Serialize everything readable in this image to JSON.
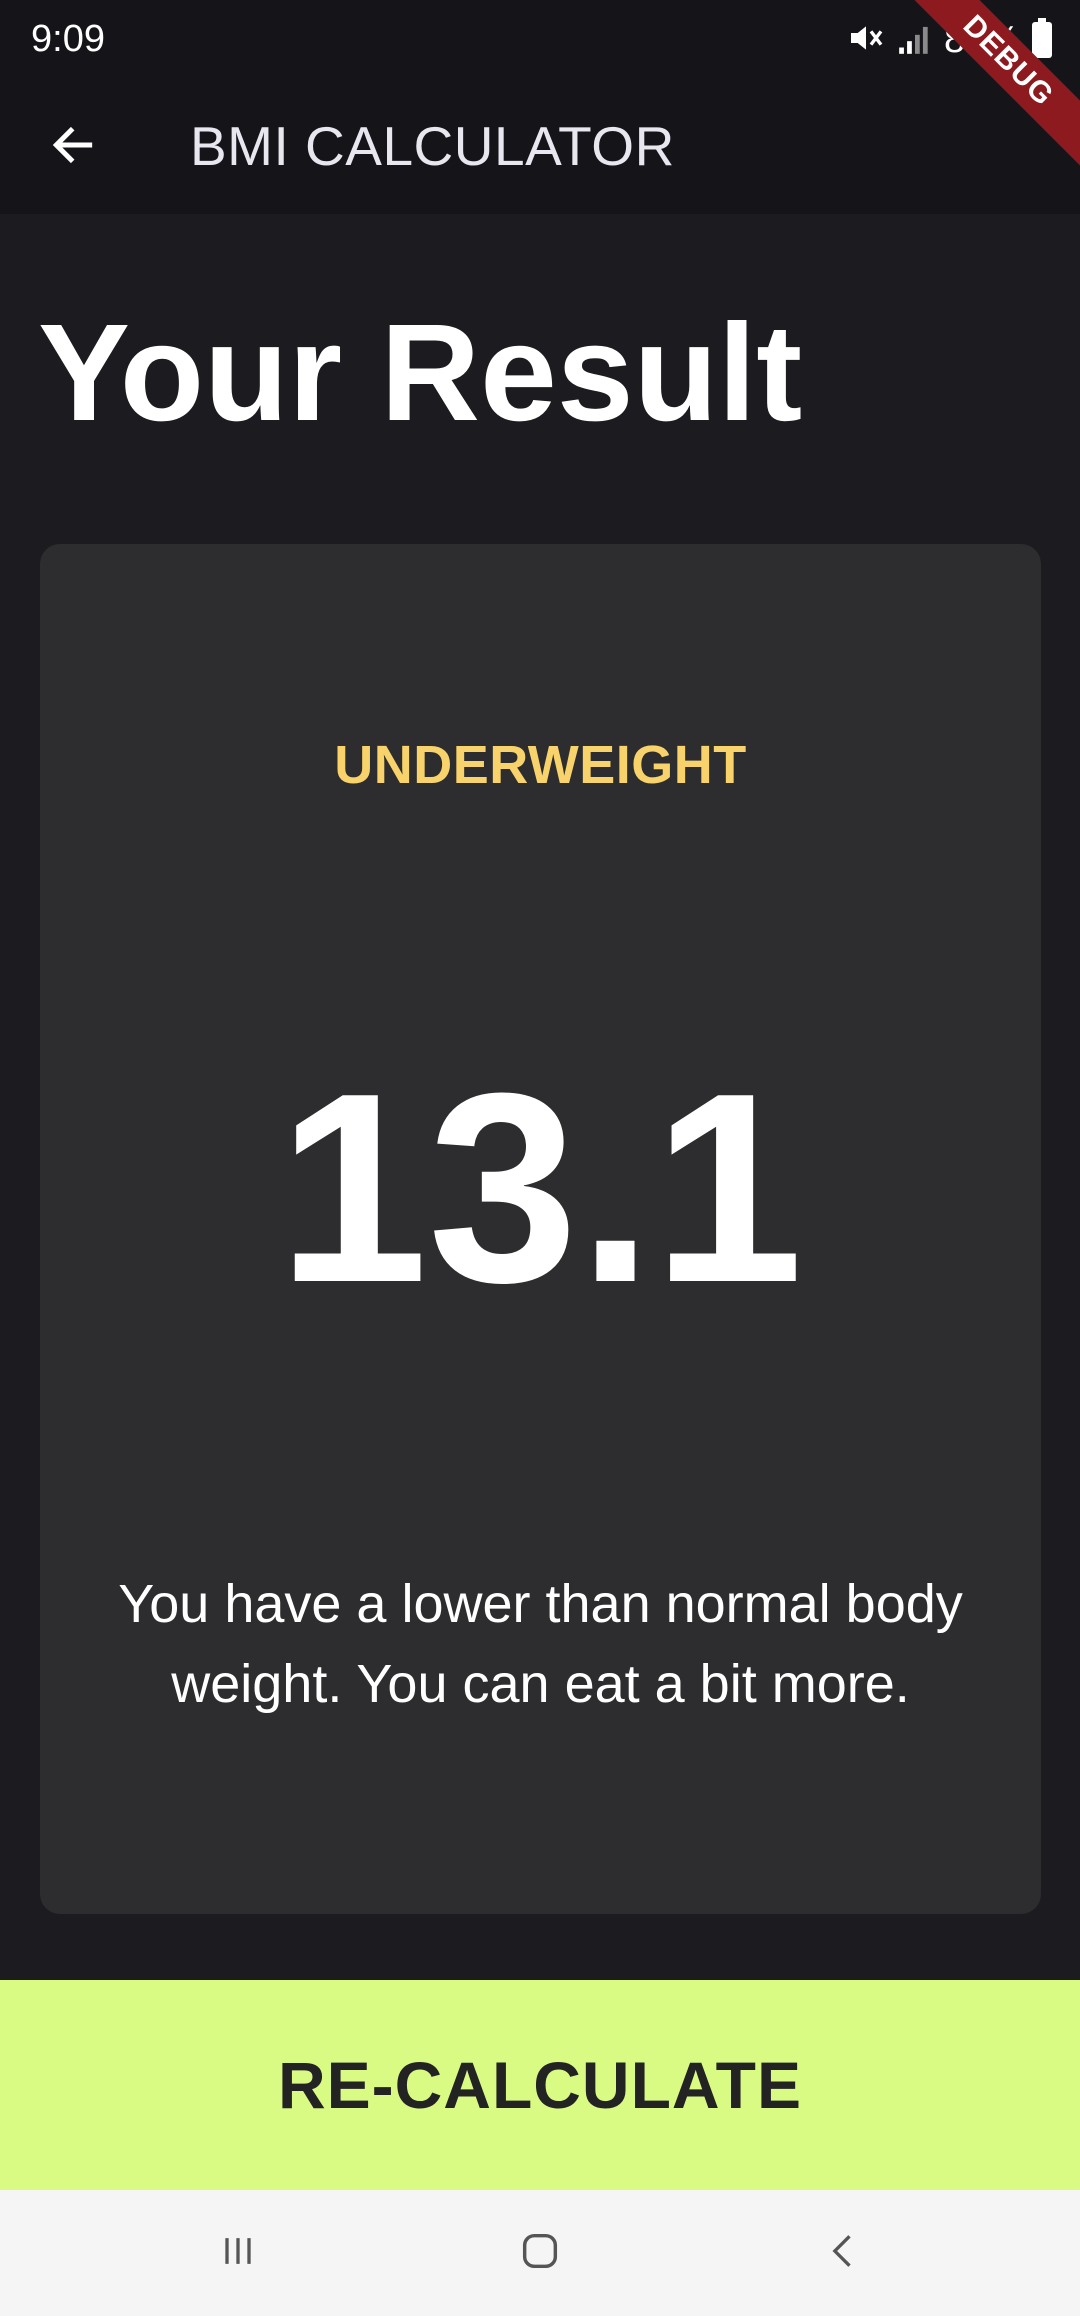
{
  "status_bar": {
    "time": "9:09",
    "battery": "85%",
    "icons": [
      "mute-icon",
      "signal-icon",
      "battery-icon"
    ]
  },
  "app_bar": {
    "title": "BMI CALCULATOR",
    "back_icon": "arrow-left-icon"
  },
  "debug_banner": {
    "label": "DEBUG"
  },
  "page": {
    "heading": "Your Result"
  },
  "result": {
    "category": "UNDERWEIGHT",
    "bmi": "13.1",
    "message": "You have a lower than normal body weight. You can eat a bit more."
  },
  "footer": {
    "button_label": "RE-CALCULATE"
  },
  "nav_bar": {
    "items": [
      "recent-apps-icon",
      "home-icon",
      "back-icon"
    ]
  },
  "colors": {
    "background": "#1c1b20",
    "app_bar": "#151419",
    "card": "#2d2d2f",
    "category": "#f8d26a",
    "button": "#d9fb84",
    "button_text": "#232323",
    "debug_ribbon": "#8c1a1f"
  }
}
